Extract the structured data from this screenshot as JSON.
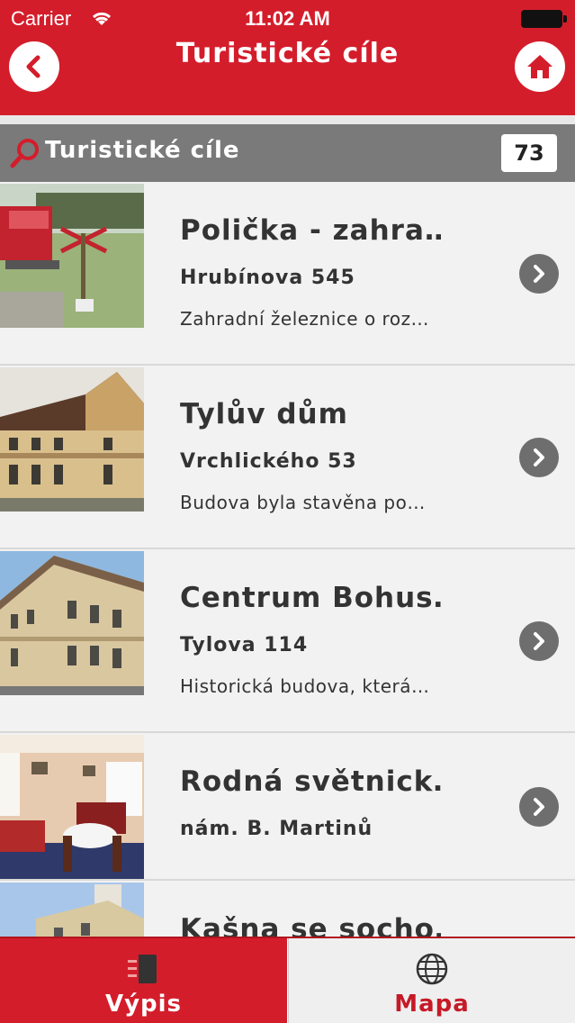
{
  "status_bar": {
    "carrier": "Carrier",
    "time": "11:02 AM"
  },
  "header": {
    "title": "Turistické cíle",
    "back_icon": "chevron-left-icon",
    "home_icon": "home-icon"
  },
  "section": {
    "title": "Turistické cíle",
    "count": "73",
    "icon": "search-icon"
  },
  "items": [
    {
      "name": "Polička - zahra…",
      "address": "Hrubínova 545",
      "description": "Zahradní železnice o roz…"
    },
    {
      "name": "Tylův dům",
      "address": "Vrchlického 53",
      "description": "Budova byla stavěna po…"
    },
    {
      "name": "Centrum Bohus…",
      "address": "Tylova 114",
      "description": "Historická budova, která…"
    },
    {
      "name": "Rodná světnick…",
      "address": "nám. B. Martinů",
      "description": ""
    },
    {
      "name": "Kašna se socho…",
      "address": "",
      "description": ""
    }
  ],
  "tabs": [
    {
      "label": "Výpis",
      "icon": "list-icon",
      "active": true
    },
    {
      "label": "Mapa",
      "icon": "globe-icon",
      "active": false
    }
  ],
  "colors": {
    "brand_red": "#d41d2b",
    "section_gray": "#7a7a7a",
    "row_bg": "#f2f2f2"
  }
}
